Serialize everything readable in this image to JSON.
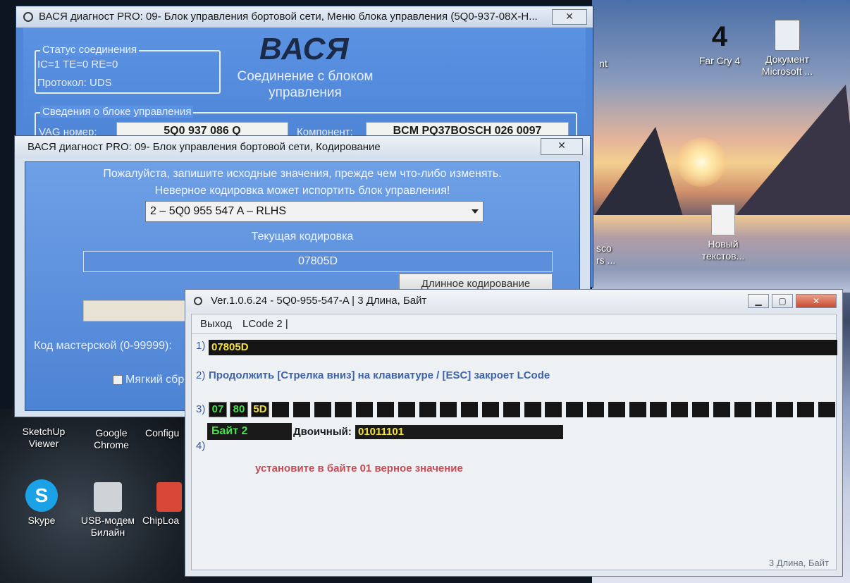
{
  "desktop": {
    "icons": [
      {
        "id": "farcry",
        "label_line1": "Far Cry 4",
        "label_line2": ""
      },
      {
        "id": "doc",
        "label_line1": "Документ",
        "label_line2": "Microsoft ..."
      },
      {
        "id": "newtxt",
        "label_line1": "Новый",
        "label_line2": "текстов..."
      },
      {
        "id": "sketchup",
        "label_line1": "SketchUp",
        "label_line2": "Viewer"
      },
      {
        "id": "chrome",
        "label_line1": "Google",
        "label_line2": "Chrome"
      },
      {
        "id": "config",
        "label_line1": "Configu",
        "label_line2": ""
      },
      {
        "id": "skype",
        "label_line1": "Skype",
        "label_line2": ""
      },
      {
        "id": "usbmodem",
        "label_line1": "USB-модем",
        "label_line2": "Билайн"
      },
      {
        "id": "chiploader",
        "label_line1": "ChipLoa",
        "label_line2": ""
      }
    ],
    "partial_labels": {
      "nt": "nt",
      "sco": "sco",
      "rs": "rs ..."
    }
  },
  "main_window": {
    "title": "ВАСЯ диагност PRO: 09- Блок управления бортовой сети,  Меню блока управления (5Q0-937-08X-H...",
    "close_label": "✕",
    "logo": "ВАСЯ",
    "connection_title": "Соединение с блоком управления",
    "status_group": {
      "title": "Статус соединения",
      "line1": "IC=1  TE=0  RE=0",
      "line2": "Протокол: UDS"
    },
    "info_group": {
      "title": "Сведения о блоке управления",
      "vag_label": "VAG номер:",
      "vag_value": "5Q0 937 086 Q",
      "component_label": "Компонент:",
      "component_value": "BCM PQ37BOSCH 026 0097"
    }
  },
  "coding_window": {
    "title": "ВАСЯ диагност PRO: 09- Блок управления бортовой сети,  Кодирование",
    "close_label": "✕",
    "warning_line1": "Пожалуйста, запишите исходные значения, прежде чем что-либо изменять.",
    "warning_line2": "Неверное кодировка может испортить блок управления!",
    "dropdown_value": "2 – 5Q0 955 547 A – RLHS",
    "current_coding_label": "Текущая кодировка",
    "current_coding_value": "07805D",
    "long_coding_button": "Длинное кодирование",
    "workshop_label": "Код мастерской (0-99999):",
    "soft_reset_label": "Мягкий сброс"
  },
  "lcode_window": {
    "title": "Ver.1.0.6.24 -    5Q0-955-547-A | 3 Длина, Байт",
    "minimize_label": "▁",
    "maximize_label": "▢",
    "close_label": "✕",
    "menu": {
      "exit": "Выход",
      "lcode": "LCode 2 |"
    },
    "row1_num": "1)",
    "row1_value": "07805D",
    "row2_num": "2)",
    "row2_text": "Продолжить [Стрелка вниз] на клавиатуре / [ESC] закроет LCode",
    "row3_num": "3)",
    "bytes": [
      "07",
      "80",
      "5D"
    ],
    "empty_cells": 27,
    "byte_label": "Байт 2",
    "binary_label": "Двоичный:",
    "binary_value": "01011101",
    "row4_num": "4)",
    "message": "установите в байте 01 верное значение",
    "status": "3 Длина, Байт"
  },
  "colors": {
    "window_blue": "#4f86d8",
    "highlight_yellow": "#f5e23c",
    "byte_green": "#48e04e",
    "message_red": "#c64b56",
    "prompt_blue": "#3e63a9"
  }
}
